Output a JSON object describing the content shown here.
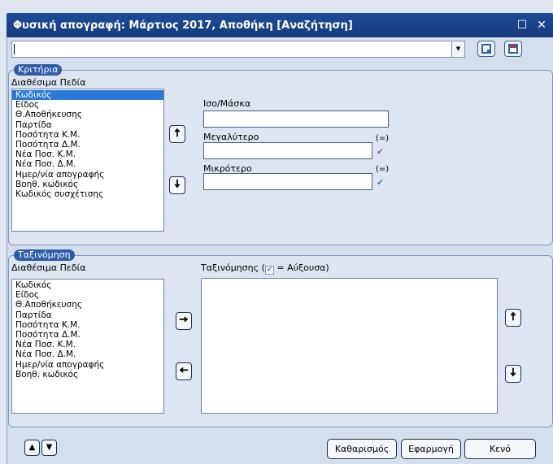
{
  "window": {
    "title": "Φυσική απογραφή: Μάρτιος 2017, Αποθήκη [Αναζήτηση]",
    "maximize_glyph": "☐",
    "close_glyph": "✕"
  },
  "toolbar": {
    "search_value": "",
    "dropdown_glyph": "▼"
  },
  "criteria": {
    "group_label": "Κριτήρια",
    "fields_label": "Διαθέσιμα Πεδία",
    "fields": [
      "Κωδικός",
      "Είδος",
      "Θ.Αποθήκευσης",
      "Παρτίδα",
      "Ποσότητα Κ.Μ.",
      "Ποσότητα Δ.Μ.",
      "Νέα Ποσ. Κ.Μ.",
      "Νέα Ποσ. Δ.Μ.",
      "Ημερ/νία απογραφής",
      "Βοηθ. κωδικός",
      "Κωδικός συσχέτισης"
    ],
    "selected_field": "Κωδικός",
    "mask_label": "Ισο/Μάσκα",
    "mask_value": "",
    "greater_label": "Μεγαλύτερο",
    "greater_value": "",
    "less_label": "Μικρότερο",
    "less_value": "",
    "equal_label": "(=)",
    "check_glyph": "✔",
    "up_glyph": "🠅",
    "down_glyph": "🠇"
  },
  "sorting": {
    "group_label": "Ταξινόμηση",
    "fields_label": "Διαθέσιμα Πεδία",
    "fields": [
      "Κωδικός",
      "Είδος",
      "Θ.Αποθήκευσης",
      "Παρτίδα",
      "Ποσότητα Κ.Μ.",
      "Ποσότητα Δ.Μ.",
      "Νέα Ποσ. Κ.Μ.",
      "Νέα Ποσ. Δ.Μ.",
      "Ημερ/νία απογραφής",
      "Βοηθ. κωδικός"
    ],
    "sort_label_prefix": "Ταξινόμησης (",
    "sort_label_suffix": " = Αύξουσα)",
    "sorted_fields": [],
    "right_glyph": "🠆",
    "left_glyph": "🠄",
    "up_glyph": "🠅",
    "down_glyph": "🠇"
  },
  "footer": {
    "nav_up_glyph": "▲",
    "nav_down_glyph": "▼",
    "clear_label": "Καθαρισμός",
    "apply_label": "Εφαρμογή",
    "empty_label": "Κενό"
  }
}
